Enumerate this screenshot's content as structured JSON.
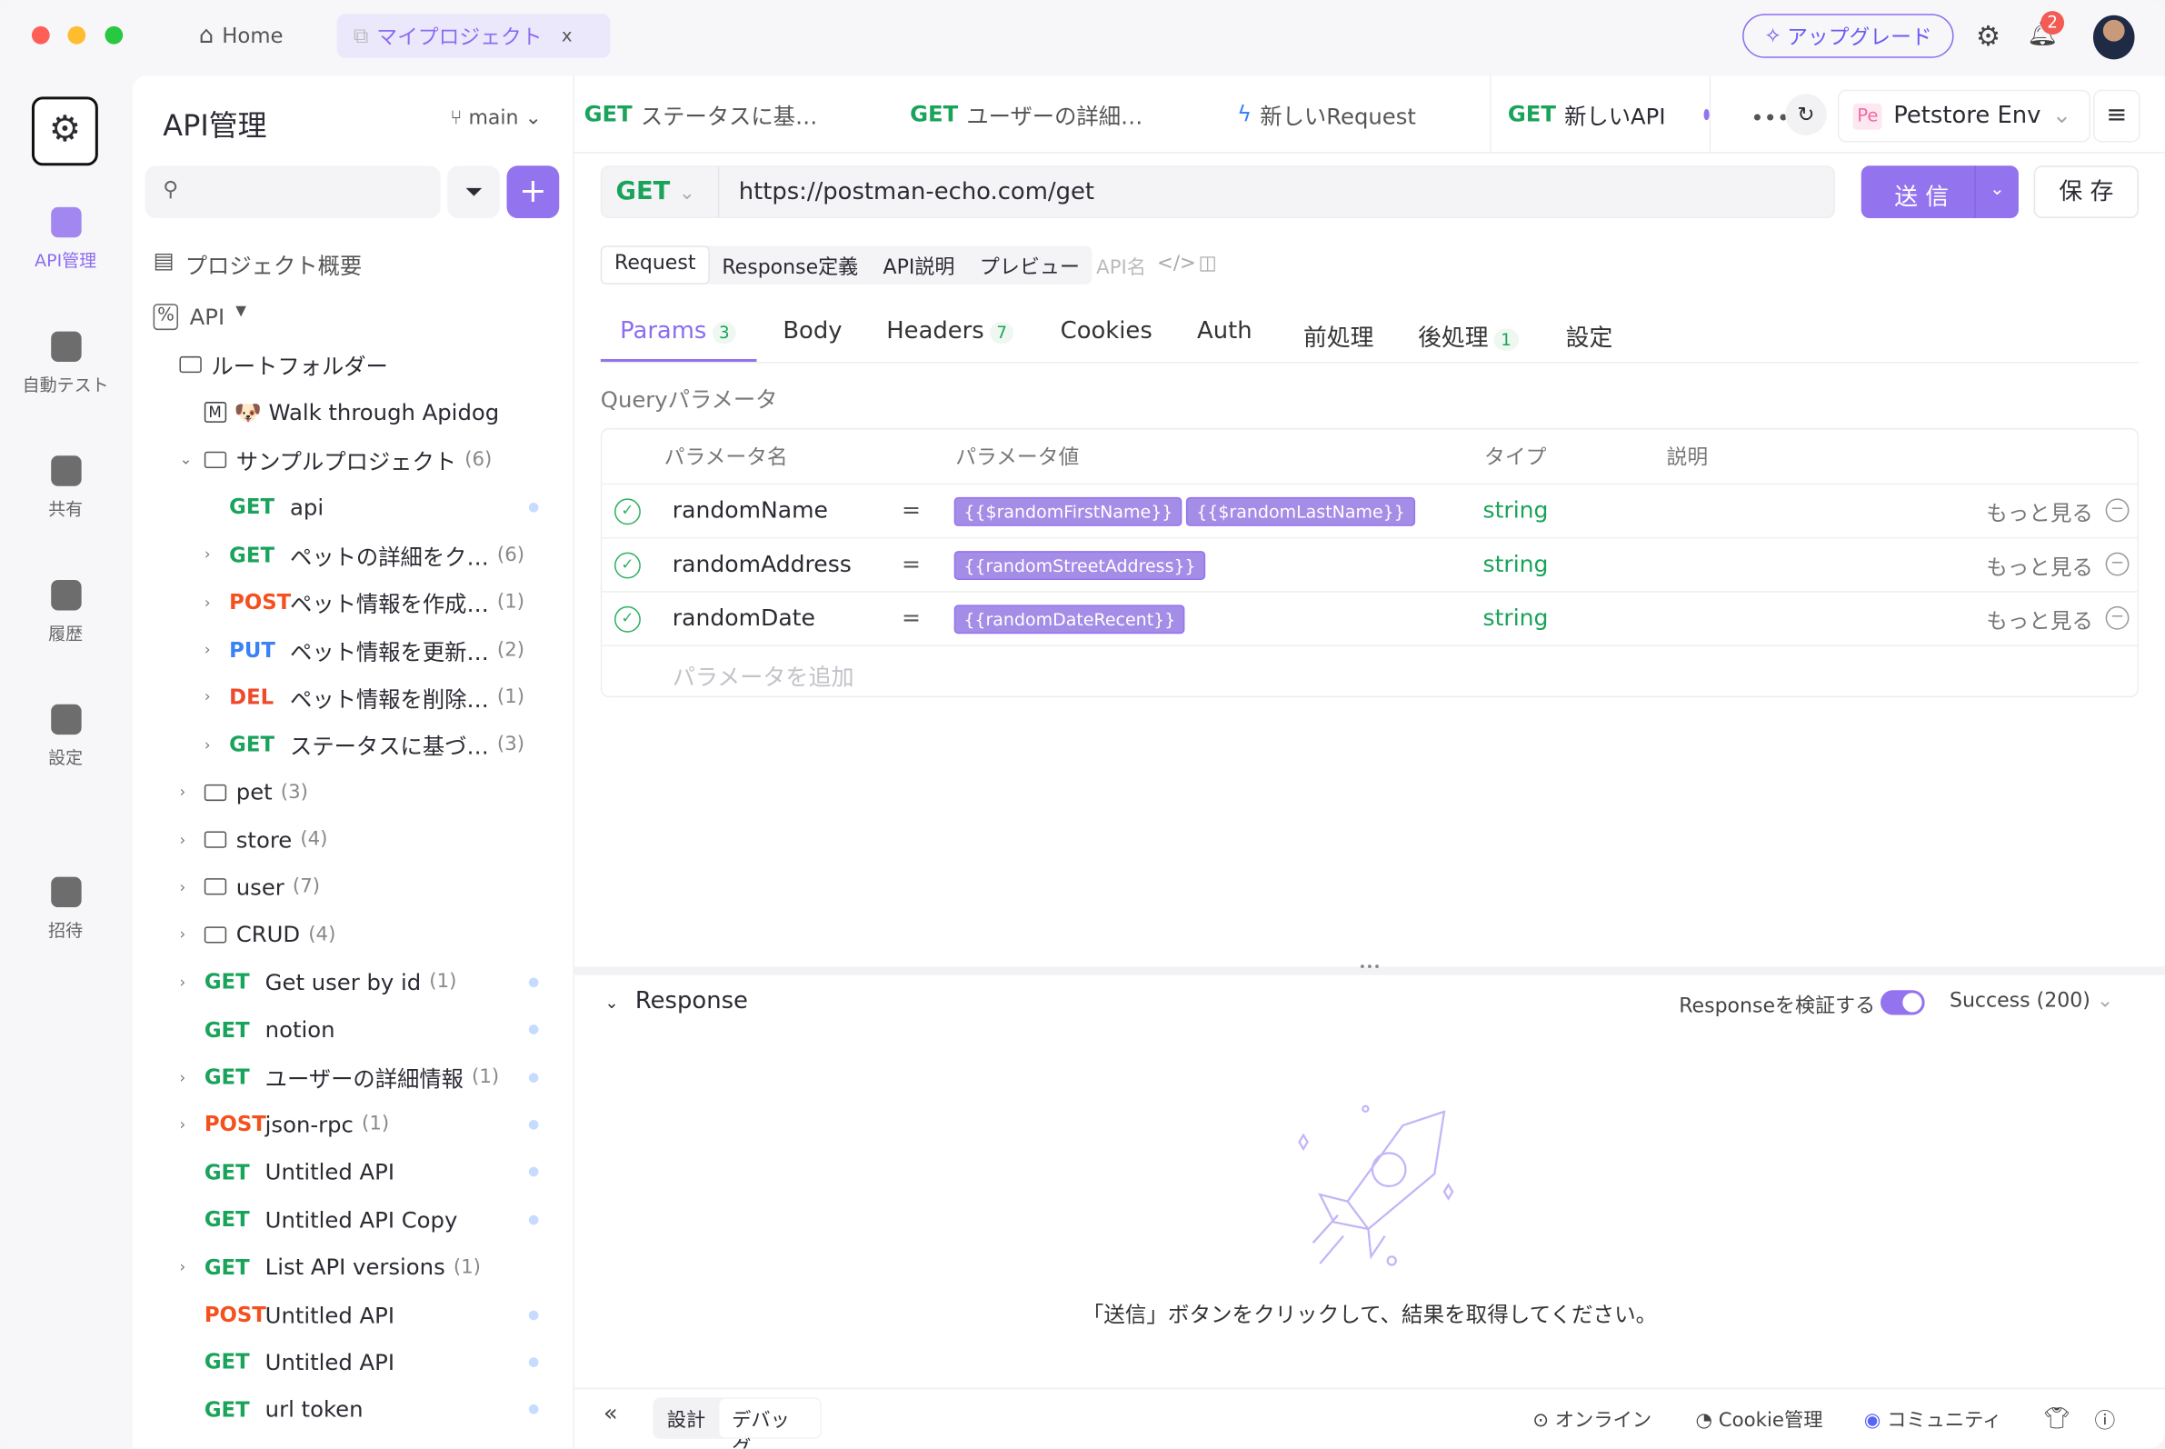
{
  "colors": {
    "accent": "#9373ee",
    "get": "#1aa35a",
    "post": "#f4511e",
    "put": "#3b82f6",
    "del": "#ef4a2b"
  },
  "titlebar": {
    "home": "Home",
    "project_tab": "マイプロジェクト",
    "close": "x",
    "upgrade": "アップグレード",
    "notification_count": "2"
  },
  "rail": [
    {
      "label": "API管理",
      "icon": "api-icon"
    },
    {
      "label": "自動テスト",
      "icon": "test-icon"
    },
    {
      "label": "共有",
      "icon": "share-icon"
    },
    {
      "label": "履歴",
      "icon": "history-icon"
    },
    {
      "label": "設定",
      "icon": "settings-icon"
    },
    {
      "label": "招待",
      "icon": "invite-icon"
    }
  ],
  "sidebar": {
    "title": "API管理",
    "branch": "main",
    "overview": "プロジェクト概要",
    "api_root": "API",
    "tree": [
      {
        "label": "ルートフォルダー",
        "type": "folder",
        "indent": 0
      },
      {
        "label": "🐶 Walk through Apidog",
        "type": "doc",
        "indent": 1
      },
      {
        "label": "サンプルプロジェクト",
        "count": "(6)",
        "type": "folder",
        "indent": 1,
        "open": true
      },
      {
        "method": "GET",
        "label": "api",
        "indent": 2,
        "dot": true
      },
      {
        "method": "GET",
        "label": "ペットの詳細をク…",
        "count": "(6)",
        "indent": 2,
        "chev": true
      },
      {
        "method": "POST",
        "label": "ペット情報を作成…",
        "count": "(1)",
        "indent": 2,
        "chev": true
      },
      {
        "method": "PUT",
        "label": "ペット情報を更新…",
        "count": "(2)",
        "indent": 2,
        "chev": true
      },
      {
        "method": "DEL",
        "label": "ペット情報を削除…",
        "count": "(1)",
        "indent": 2,
        "chev": true
      },
      {
        "method": "GET",
        "label": "ステータスに基づ…",
        "count": "(3)",
        "indent": 2,
        "chev": true
      },
      {
        "label": "pet",
        "count": "(3)",
        "type": "folder",
        "indent": 1,
        "chev": true
      },
      {
        "label": "store",
        "count": "(4)",
        "type": "folder",
        "indent": 1,
        "chev": true
      },
      {
        "label": "user",
        "count": "(7)",
        "type": "folder",
        "indent": 1,
        "chev": true
      },
      {
        "label": "CRUD",
        "count": "(4)",
        "type": "folder",
        "indent": 1,
        "chev": true
      },
      {
        "method": "GET",
        "label": "Get user by id",
        "count": "(1)",
        "indent": 0,
        "chev": true,
        "dot": true
      },
      {
        "method": "GET",
        "label": "notion",
        "indent": 0,
        "dot": true
      },
      {
        "method": "GET",
        "label": "ユーザーの詳細情報",
        "count": "(1)",
        "indent": 0,
        "chev": true,
        "dot": true
      },
      {
        "method": "POST",
        "label": "json-rpc",
        "count": "(1)",
        "indent": 0,
        "chev": true,
        "dot": true
      },
      {
        "method": "GET",
        "label": "Untitled API",
        "indent": 0,
        "dot": true
      },
      {
        "method": "GET",
        "label": "Untitled API Copy",
        "indent": 0,
        "dot": true
      },
      {
        "method": "GET",
        "label": "List API versions",
        "count": "(1)",
        "indent": 0,
        "chev": true
      },
      {
        "method": "POST",
        "label": "Untitled API",
        "indent": 0,
        "dot": true
      },
      {
        "method": "GET",
        "label": "Untitled API",
        "indent": 0,
        "dot": true
      },
      {
        "method": "GET",
        "label": "url token",
        "indent": 0,
        "dot": true
      }
    ]
  },
  "tabs": [
    {
      "method": "GET",
      "label": "ステータスに基…"
    },
    {
      "method": "GET",
      "label": "ユーザーの詳細…"
    },
    {
      "method": "",
      "label": "新しいRequest"
    },
    {
      "method": "GET",
      "label": "新しいAPI",
      "active": true
    }
  ],
  "env": {
    "abbr": "Pe",
    "name": "Petstore Env"
  },
  "request": {
    "method": "GET",
    "url": "https://postman-echo.com/get",
    "send": "送 信",
    "save": "保 存"
  },
  "mode_tabs": [
    "Request",
    "Response定義",
    "API説明",
    "プレビュー"
  ],
  "api_name_placeholder": "API名",
  "sub_tabs": [
    {
      "label": "Params",
      "badge": "3"
    },
    {
      "label": "Body"
    },
    {
      "label": "Headers",
      "badge": "7"
    },
    {
      "label": "Cookies"
    },
    {
      "label": "Auth"
    },
    {
      "label": "前処理"
    },
    {
      "label": "後処理",
      "badge": "1"
    },
    {
      "label": "設定"
    }
  ],
  "params": {
    "section": "Queryパラメータ",
    "headers": [
      "パラメータ名",
      "パラメータ値",
      "タイプ",
      "説明"
    ],
    "rows": [
      {
        "name": "randomName",
        "values": [
          "{{$randomFirstName}}",
          "{{$randomLastName}}"
        ],
        "type": "string",
        "more": "もっと見る"
      },
      {
        "name": "randomAddress",
        "values": [
          "{{randomStreetAddress}}"
        ],
        "type": "string",
        "more": "もっと見る"
      },
      {
        "name": "randomDate",
        "values": [
          "{{randomDateRecent}}"
        ],
        "type": "string",
        "more": "もっと見る"
      }
    ],
    "add_placeholder": "パラメータを追加"
  },
  "response": {
    "title": "Response",
    "validate": "Responseを検証する",
    "validate_on": true,
    "status": "Success (200)",
    "empty": "「送信」ボタンをクリックして、結果を取得してください。"
  },
  "footer": {
    "design": "設計",
    "debug": "デバッグ",
    "online": "オンライン",
    "cookie": "Cookie管理",
    "community": "コミュニティ"
  }
}
